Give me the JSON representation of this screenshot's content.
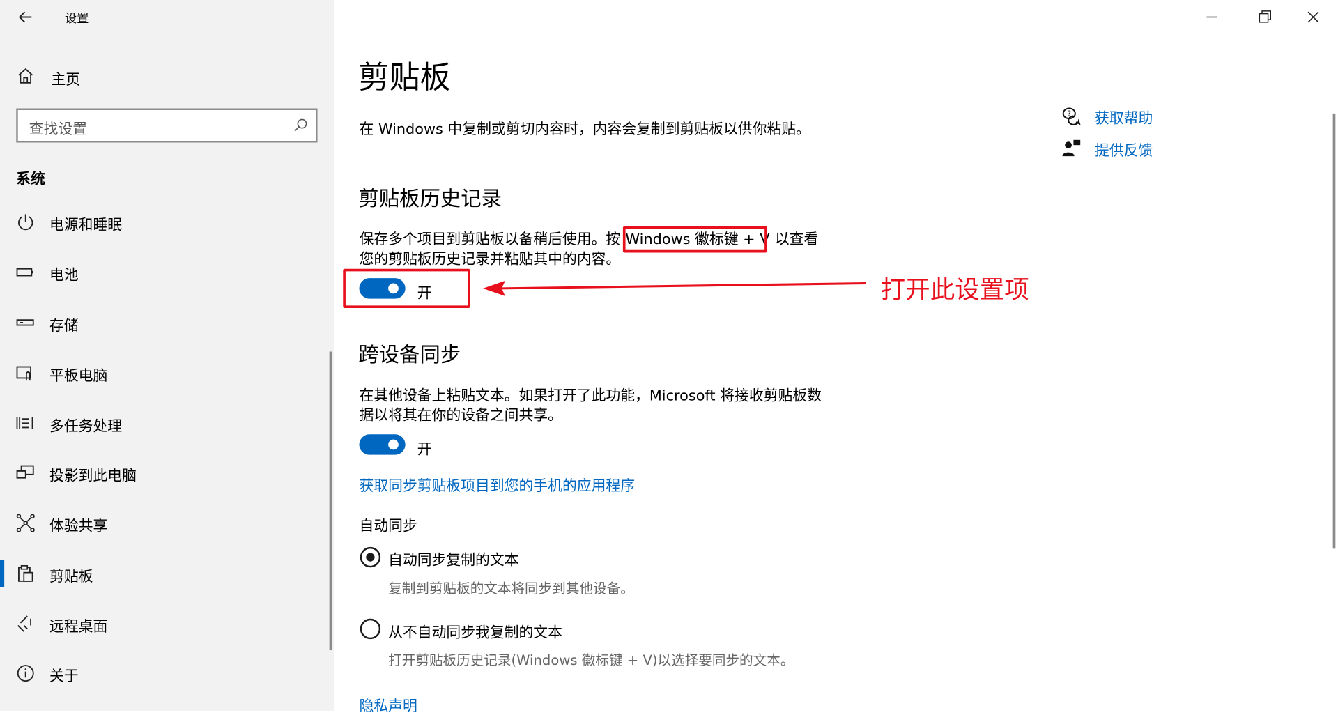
{
  "window": {
    "title": "设置"
  },
  "sidebar": {
    "home_label": "主页",
    "search_placeholder": "查找设置",
    "section_label": "系统",
    "items": [
      {
        "label": "电源和睡眠",
        "icon": "power-icon"
      },
      {
        "label": "电池",
        "icon": "battery-icon"
      },
      {
        "label": "存储",
        "icon": "storage-icon"
      },
      {
        "label": "平板电脑",
        "icon": "tablet-icon"
      },
      {
        "label": "多任务处理",
        "icon": "multitask-icon"
      },
      {
        "label": "投影到此电脑",
        "icon": "project-icon"
      },
      {
        "label": "体验共享",
        "icon": "share-icon"
      },
      {
        "label": "剪贴板",
        "icon": "clipboard-icon",
        "selected": true
      },
      {
        "label": "远程桌面",
        "icon": "remote-desktop-icon"
      },
      {
        "label": "关于",
        "icon": "info-icon"
      }
    ]
  },
  "main": {
    "title": "剪贴板",
    "description": "在 Windows 中复制或剪切内容时，内容会复制到剪贴板以供你粘贴。",
    "help": {
      "get_help": "获取帮助",
      "feedback": "提供反馈"
    },
    "history": {
      "heading": "剪贴板历史记录",
      "desc_part1": "保存多个项目到剪贴板以备稍后使用。按",
      "desc_key": "Windows 徽标键 + V",
      "desc_part2": "以查看",
      "desc_line2": "您的剪贴板历史记录并粘贴其中的内容。",
      "toggle_label": "开"
    },
    "sync": {
      "heading": "跨设备同步",
      "desc_line1": "在其他设备上粘贴文本。如果打开了此功能，Microsoft 将接收剪贴板数",
      "desc_line2": "据以将其在你的设备之间共享。",
      "toggle_label": "开",
      "phone_link": "获取同步剪贴板项目到您的手机的应用程序",
      "auto_label": "自动同步",
      "option1": "自动同步复制的文本",
      "option1_desc": "复制到剪贴板的文本将同步到其他设备。",
      "option2": "从不自动同步我复制的文本",
      "option2_desc": "打开剪贴板历史记录(Windows 徽标键 + V)以选择要同步的文本。",
      "privacy_link": "隐私声明"
    }
  },
  "annotation": {
    "text": "打开此设置项"
  },
  "colors": {
    "accent": "#0067c0",
    "annotation": "#e8101c",
    "sidebar_bg": "#f2f2f2"
  }
}
